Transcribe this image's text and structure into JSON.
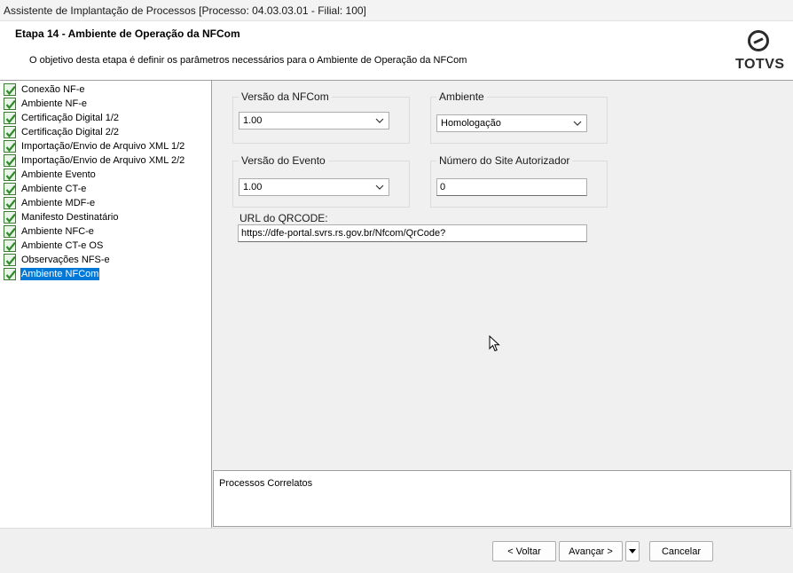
{
  "window": {
    "title": "Assistente de Implantação de Processos [Processo: 04.03.03.01 - Filial: 100]"
  },
  "header": {
    "step_title": "Etapa 14 - Ambiente de Operação da NFCom",
    "description": "O objetivo desta etapa é definir os parâmetros necessários para o Ambiente de Operação da NFCom",
    "logo_text": "TOTVS"
  },
  "steps": [
    "Conexão NF-e",
    "Ambiente NF-e",
    "Certificação Digital 1/2",
    "Certificação Digital 2/2",
    "Importação/Envio de Arquivo XML 1/2",
    "Importação/Envio de Arquivo XML 2/2",
    "Ambiente Evento",
    "Ambiente CT-e",
    "Ambiente MDF-e",
    "Manifesto Destinatário",
    "Ambiente NFC-e",
    "Ambiente CT-e OS",
    "Observações NFS-e",
    "Ambiente NFCom"
  ],
  "form": {
    "versao_nfcom": {
      "label": "Versão da NFCom",
      "value": "1.00"
    },
    "ambiente": {
      "label": "Ambiente",
      "value": "Homologação"
    },
    "versao_evento": {
      "label": "Versão do Evento",
      "value": "1.00"
    },
    "numero_site": {
      "label": "Número do Site Autorizador",
      "value": "0"
    },
    "url_qrcode": {
      "label": "URL do QRCODE:",
      "value": "https://dfe-portal.svrs.rs.gov.br/Nfcom/QrCode?"
    }
  },
  "related": {
    "title": "Processos Correlatos"
  },
  "buttons": {
    "back": "< Voltar",
    "next": "Avançar >",
    "cancel": "Cancelar"
  },
  "icons": {
    "step_check": "checkbox-checked-icon",
    "dropdown": "chevron-down-icon",
    "logo": "totvs-logo-icon"
  },
  "colors": {
    "selection": "#0078d7",
    "check_green": "#3a7a35"
  }
}
